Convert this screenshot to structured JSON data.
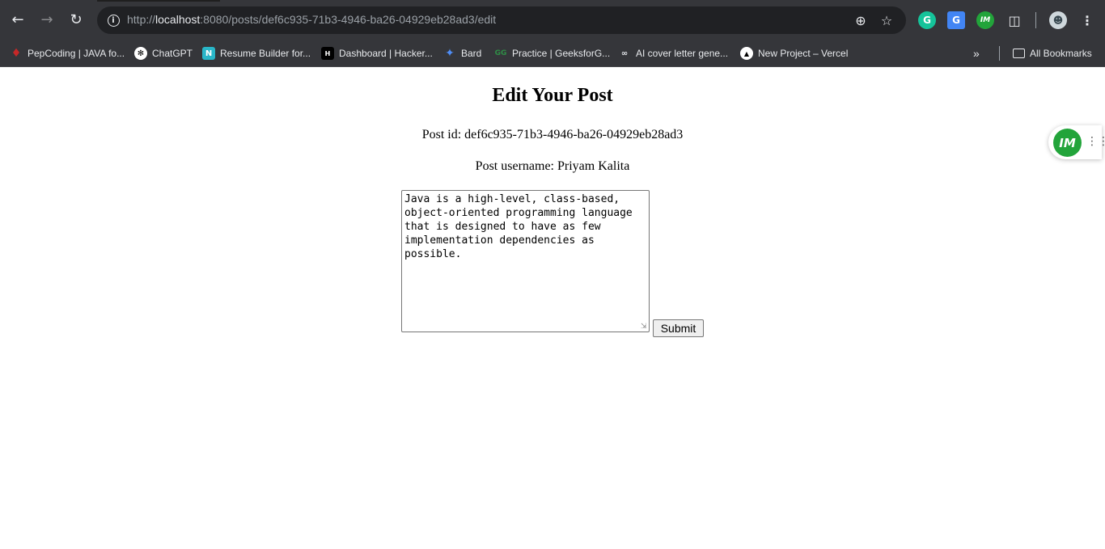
{
  "browser": {
    "url": {
      "scheme": "http://",
      "host": "localhost",
      "rest": ":8080/posts/def6c935-71b3-4946-ba26-04929eb28ad3/edit"
    },
    "bookmarks": [
      {
        "label": "PepCoding | JAVA fo...",
        "icon": "pepcoding-icon",
        "color": "#c62828"
      },
      {
        "label": "ChatGPT",
        "icon": "chatgpt-icon",
        "color": "#ffffff"
      },
      {
        "label": "Resume Builder for...",
        "icon": "resume-builder-icon",
        "color": "#29b6c8"
      },
      {
        "label": "Dashboard | Hacker...",
        "icon": "hackerrank-icon",
        "color": "#000000"
      },
      {
        "label": "Bard",
        "icon": "bard-icon",
        "color": "#4f8ef7"
      },
      {
        "label": "Practice | GeeksforG...",
        "icon": "geeksforgeeks-icon",
        "color": "#2f8d46"
      },
      {
        "label": "AI cover letter gene...",
        "icon": "ai-cover-letter-icon",
        "color": "#e8eaed"
      },
      {
        "label": "New Project – Vercel",
        "icon": "vercel-icon",
        "color": "#000000"
      }
    ],
    "all_bookmarks_label": "All Bookmarks"
  },
  "page": {
    "heading": "Edit Your Post",
    "post_id": "Post id: def6c935-71b3-4946-ba26-04929eb28ad3",
    "post_username": "Post username: Priyam Kalita",
    "content_value": "Java is a high-level, class-based, object-oriented programming language that is designed to have as few implementation dependencies as possible.",
    "submit_label": "Submit"
  },
  "widget": {
    "logo_text": "IM",
    "accent": "#22a43a"
  }
}
